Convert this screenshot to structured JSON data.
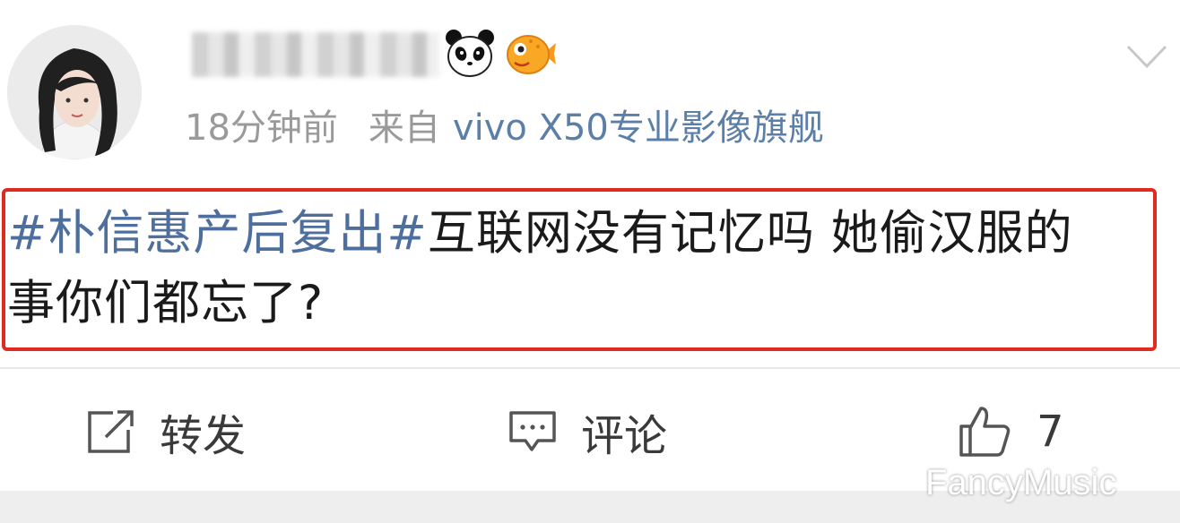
{
  "post": {
    "time_ago": "18分钟前",
    "source_prefix": "来自",
    "source_device": "vivo X50专业影像旗舰",
    "hashtag": "#朴信惠产后复出#",
    "text_line1": "互联网没有记忆吗 她偷汉服的",
    "text_line2": "事你们都忘了?"
  },
  "actions": {
    "repost_label": "转发",
    "comment_label": "评论",
    "like_count": "7"
  },
  "watermark": "FancyMusic",
  "colors": {
    "hashtag": "#4e6f9e",
    "source": "#5c7fa8",
    "highlight_border": "#e02a22"
  }
}
